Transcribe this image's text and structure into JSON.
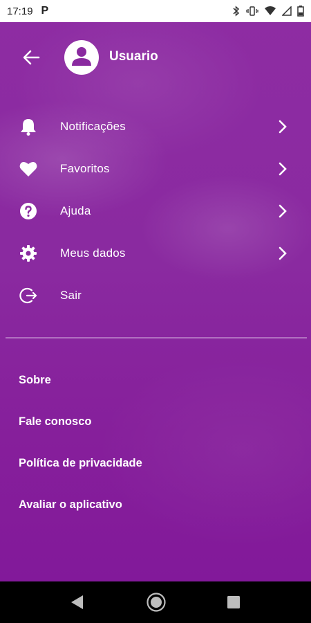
{
  "status_bar": {
    "time": "17:19",
    "app_indicator": "P",
    "icons": [
      "bluetooth-icon",
      "vibrate-icon",
      "wifi-icon",
      "signal-icon",
      "battery-icon"
    ]
  },
  "header": {
    "back_icon": "arrow-left-icon",
    "avatar_icon": "user-icon",
    "user_name": "Usuario"
  },
  "menu": {
    "items": [
      {
        "label": "Notificações",
        "icon": "bell-icon",
        "has_chevron": true
      },
      {
        "label": "Favoritos",
        "icon": "heart-icon",
        "has_chevron": true
      },
      {
        "label": "Ajuda",
        "icon": "help-icon",
        "has_chevron": true
      },
      {
        "label": "Meus dados",
        "icon": "gear-icon",
        "has_chevron": true
      },
      {
        "label": "Sair",
        "icon": "logout-icon",
        "has_chevron": false
      }
    ]
  },
  "links": [
    {
      "label": "Sobre"
    },
    {
      "label": "Fale conosco"
    },
    {
      "label": "Política de privacidade"
    },
    {
      "label": "Avaliar o aplicativo"
    }
  ],
  "nav_bar": {
    "icons": [
      "nav-back-icon",
      "nav-home-icon",
      "nav-recents-icon"
    ]
  },
  "colors": {
    "background": "#8a2aa0",
    "text": "#ffffff",
    "status_bar": "#ffffff",
    "nav_bar": "#000000"
  }
}
